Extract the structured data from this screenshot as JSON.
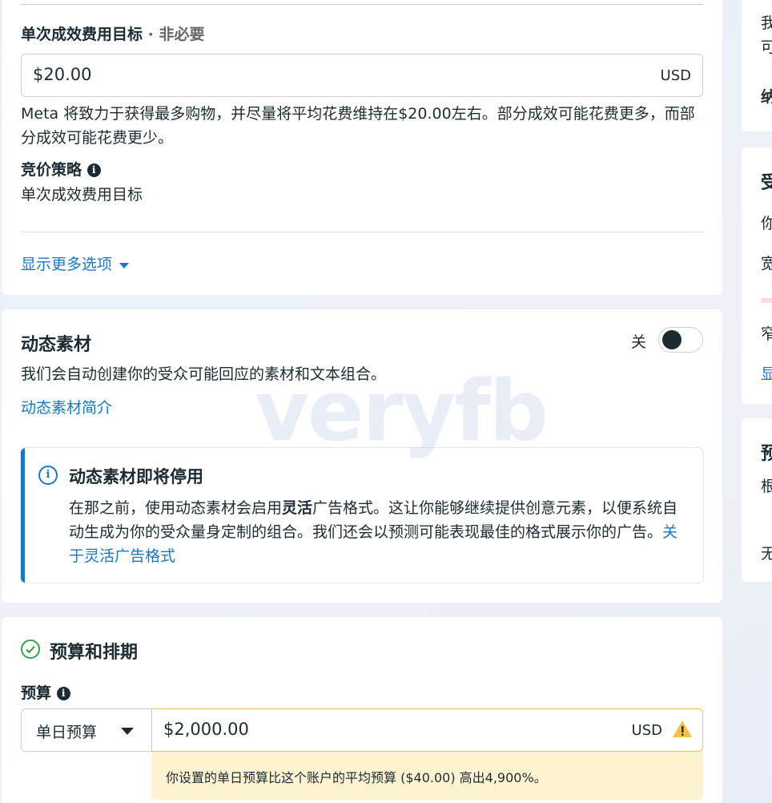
{
  "bid": {
    "label": "单次成效费用目标",
    "optional": " · 非必要",
    "value": "$20.00",
    "currency": "USD",
    "description": "Meta 将致力于获得最多购物，并尽量将平均花费维持在$20.00左右。部分成效可能花费更多，而部分成效可能花费更少。",
    "strategy_label": "竞价策略",
    "strategy_value": "单次成效费用目标",
    "more_options": "显示更多选项"
  },
  "dynamic": {
    "title": "动态素材",
    "toggle_label": "关",
    "description": "我们会自动创建你的受众可能回应的素材和文本组合。",
    "intro_link": "动态素材简介",
    "notice_title": "动态素材即将停用",
    "notice_text_1": "在那之前，使用动态素材会启用",
    "notice_bold": "灵活",
    "notice_text_2": "广告格式。这让你能够继续提供创意元素，以便系统自动生成为你的受众量身定制的组合。我们还会以预测可能表现最佳的格式展示你的广告。",
    "notice_link": "关于灵活广告格式"
  },
  "budget": {
    "section_title": "预算和排期",
    "label": "预算",
    "type": "单日预算",
    "value": "$2,000.00",
    "currency": "USD",
    "warning": "你设置的单日预算比这个账户的平均预算 ($40.00) 高出4,900%。"
  },
  "watermark": "veryfb",
  "sidebar": {
    "c1": "我",
    "c2": "可",
    "c3": "纳",
    "c4": "受",
    "c5": "你",
    "c6": "宽",
    "c7": "窄",
    "c8": "显",
    "c9": "预",
    "c10": "根",
    "c11": "无"
  },
  "colors": {
    "link": "#1877c7",
    "warning_bg": "#fdf3d1",
    "warning_icon": "#f5c33b",
    "check": "#31a24c"
  }
}
